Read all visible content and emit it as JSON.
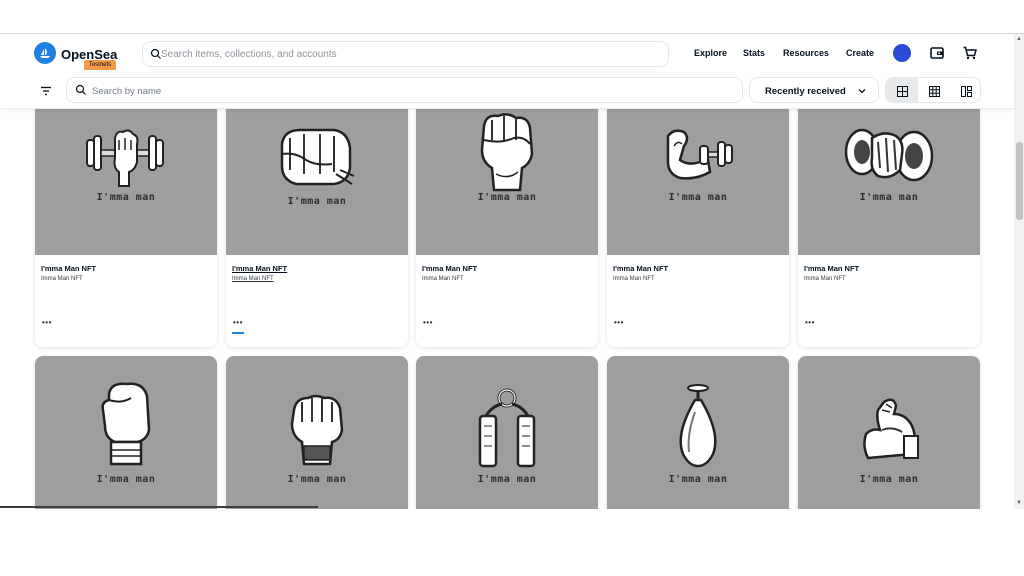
{
  "header": {
    "brand": "OpenSea",
    "badge": "Testnets",
    "search_placeholder": "Search items, collections, and accounts",
    "nav": [
      "Explore",
      "Stats",
      "Resources",
      "Create"
    ],
    "accent_color": "#2081e2",
    "avatar_color": "#2a4bd8",
    "icons": [
      "opensea-logo-icon",
      "search-icon",
      "wallet-icon",
      "cart-icon"
    ]
  },
  "toolbar": {
    "name_search_placeholder": "Search by name",
    "sort_label": "Recently received",
    "icons": [
      "filter-icon",
      "search-icon",
      "chevron-down-icon",
      "grid-large-icon",
      "grid-small-icon",
      "grid-compact-icon"
    ]
  },
  "cards": [
    {
      "title": "I'mma Man NFT",
      "collection": "Imma Man NFT",
      "caption": "I'mma man",
      "art": "dumbbell-fist"
    },
    {
      "title": "I'mma Man NFT",
      "collection": "Imma Man NFT",
      "caption": "I'mma man",
      "art": "punch-fist"
    },
    {
      "title": "I'mma Man NFT",
      "collection": "Imma Man NFT",
      "caption": "I'mma man",
      "art": "raised-fist"
    },
    {
      "title": "I'mma Man NFT",
      "collection": "Imma Man NFT",
      "caption": "I'mma man",
      "art": "arm-dumbbell"
    },
    {
      "title": "I'mma Man NFT",
      "collection": "Imma Man NFT",
      "caption": "I'mma man",
      "art": "dumbbell-grip"
    },
    {
      "caption": "I'mma man",
      "art": "boxing-glove"
    },
    {
      "caption": "I'mma man",
      "art": "mma-glove"
    },
    {
      "caption": "I'mma man",
      "art": "hand-grip"
    },
    {
      "caption": "I'mma man",
      "art": "speed-bag"
    },
    {
      "caption": "I'mma man",
      "art": "flexed-bicep"
    }
  ],
  "more_label": "•••"
}
